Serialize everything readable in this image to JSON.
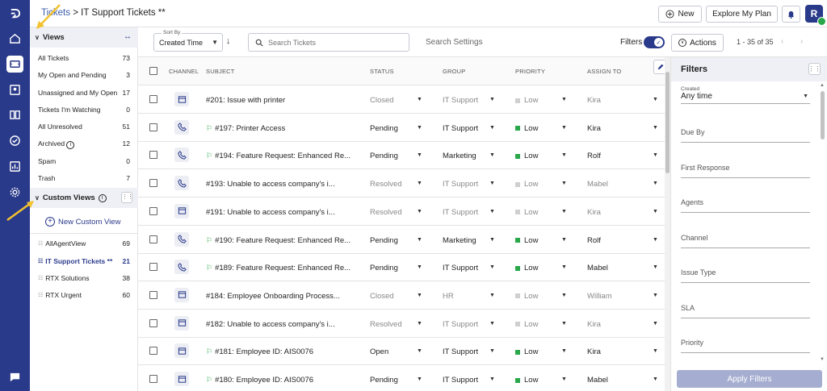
{
  "breadcrumb": {
    "root": "Tickets",
    "sep": ">",
    "current": "IT Support Tickets **"
  },
  "header": {
    "new_label": "New",
    "explore_label": "Explore My Plan",
    "avatar_initial": "R"
  },
  "sidebar": {
    "views_title": "Views",
    "views": [
      {
        "label": "All Tickets",
        "count": "73"
      },
      {
        "label": "My Open and Pending",
        "count": "3"
      },
      {
        "label": "Unassigned and My Open",
        "count": "17"
      },
      {
        "label": "Tickets I'm Watching",
        "count": "0"
      },
      {
        "label": "All Unresolved",
        "count": "51"
      },
      {
        "label": "Archived",
        "count": "12"
      },
      {
        "label": "Spam",
        "count": "0"
      },
      {
        "label": "Trash",
        "count": "7"
      }
    ],
    "custom_views_title": "Custom Views",
    "new_custom_view": "New Custom View",
    "custom_views": [
      {
        "label": "AllAgentView",
        "count": "69",
        "active": false
      },
      {
        "label": "IT Support Tickets **",
        "count": "21",
        "active": true
      },
      {
        "label": "RTX Solutions",
        "count": "38",
        "active": false
      },
      {
        "label": "RTX Urgent",
        "count": "60",
        "active": false
      }
    ]
  },
  "toolbar": {
    "sort_caption": "Sort By",
    "sort_value": "Created Time",
    "search_placeholder": "Search Tickets",
    "search_settings": "Search Settings",
    "filters_label": "Filters",
    "actions_label": "Actions",
    "pagination": "1 - 35 of 35"
  },
  "table": {
    "columns": [
      "CHANNEL",
      "SUBJECT",
      "STATUS",
      "GROUP",
      "PRIORITY",
      "ASSIGN TO"
    ],
    "rows": [
      {
        "channel": "form",
        "subject": "#201: Issue with printer",
        "status": "Closed",
        "group": "IT Support",
        "priority": "Low",
        "assignee": "Kira",
        "muted": true,
        "linked": false
      },
      {
        "channel": "phone",
        "subject": "#197: Printer Access",
        "status": "Pending",
        "group": "IT Support",
        "priority": "Low",
        "assignee": "Kira",
        "muted": false,
        "linked": true
      },
      {
        "channel": "phone",
        "subject": "#194: Feature Request: Enhanced Re...",
        "status": "Pending",
        "group": "Marketing",
        "priority": "Low",
        "assignee": "Rolf",
        "muted": false,
        "linked": true
      },
      {
        "channel": "phone",
        "subject": "#193: Unable to access company's i...",
        "status": "Resolved",
        "group": "IT Support",
        "priority": "Low",
        "assignee": "Mabel",
        "muted": true,
        "linked": false
      },
      {
        "channel": "form",
        "subject": "#191: Unable to access company's i...",
        "status": "Resolved",
        "group": "IT Support",
        "priority": "Low",
        "assignee": "Kira",
        "muted": true,
        "linked": false
      },
      {
        "channel": "phone",
        "subject": "#190: Feature Request: Enhanced Re...",
        "status": "Pending",
        "group": "Marketing",
        "priority": "Low",
        "assignee": "Rolf",
        "muted": false,
        "linked": true
      },
      {
        "channel": "phone",
        "subject": "#189: Feature Request: Enhanced Re...",
        "status": "Pending",
        "group": "IT Support",
        "priority": "Low",
        "assignee": "Mabel",
        "muted": false,
        "linked": true
      },
      {
        "channel": "form",
        "subject": "#184: Employee Onboarding Process...",
        "status": "Closed",
        "group": "HR",
        "priority": "Low",
        "assignee": "William",
        "muted": true,
        "linked": false
      },
      {
        "channel": "form",
        "subject": "#182: Unable to access company's i...",
        "status": "Resolved",
        "group": "IT Support",
        "priority": "Low",
        "assignee": "Kira",
        "muted": true,
        "linked": false
      },
      {
        "channel": "form",
        "subject": "#181: Employee ID: AIS0076",
        "status": "Open",
        "group": "IT Support",
        "priority": "Low",
        "assignee": "Kira",
        "muted": false,
        "linked": true
      },
      {
        "channel": "form",
        "subject": "#180: Employee ID: AIS0076",
        "status": "Pending",
        "group": "IT Support",
        "priority": "Low",
        "assignee": "Mabel",
        "muted": false,
        "linked": true
      }
    ]
  },
  "filters_panel": {
    "title": "Filters",
    "created_caption": "Created",
    "created_value": "Any time",
    "fields": [
      "Due By",
      "First Response",
      "Agents",
      "Channel",
      "Issue Type",
      "SLA",
      "Priority"
    ],
    "apply_label": "Apply Filters"
  },
  "colors": {
    "brand": "#2a3a8a",
    "priority_low_active": "#2aa74b",
    "priority_low_muted": "#cfcfcf",
    "link_icon": "#2aa74b",
    "annotation_arrow": "#f2c230"
  }
}
